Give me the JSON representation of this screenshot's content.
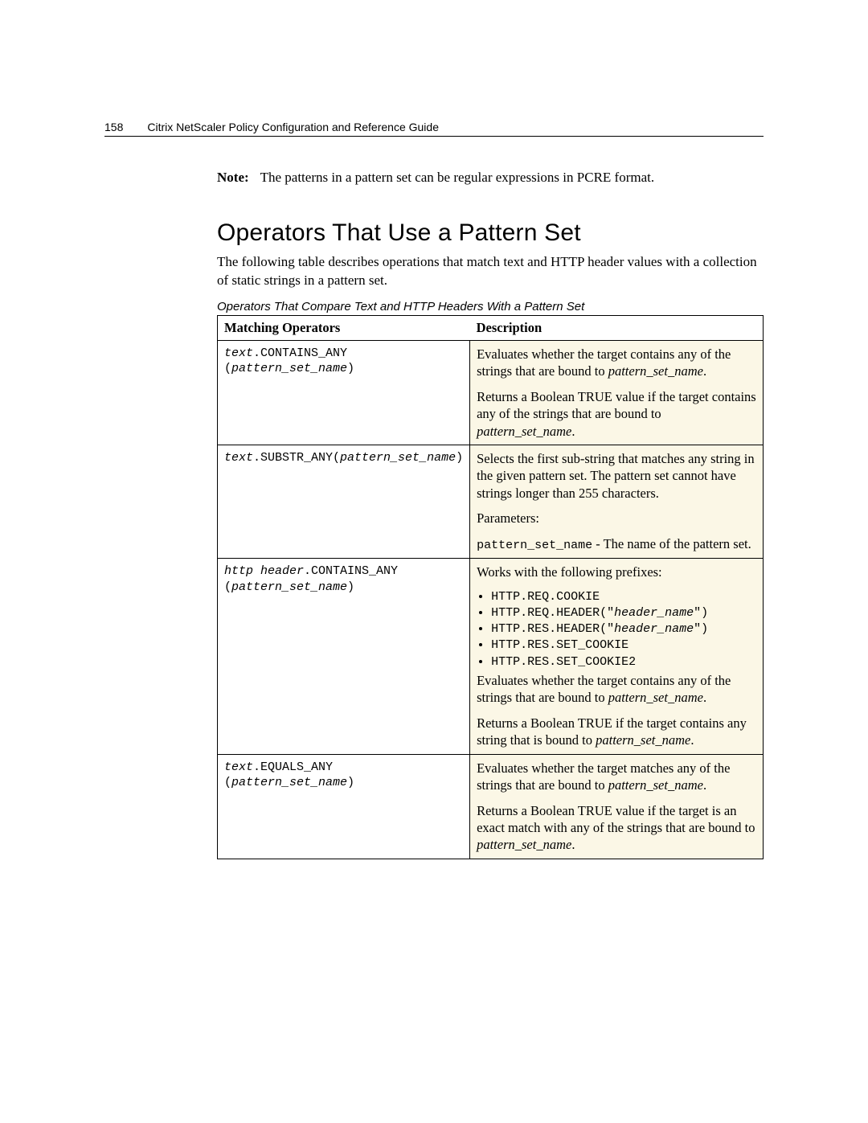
{
  "header": {
    "page_number": "158",
    "doc_title": "Citrix NetScaler Policy Configuration and Reference Guide"
  },
  "note": {
    "label": "Note:",
    "text": "The patterns in a pattern set can be regular expressions in PCRE format."
  },
  "section": {
    "title": "Operators That Use a Pattern Set",
    "intro": "The following table describes operations that match text and HTTP header values with a collection of static strings in a pattern set.",
    "caption": "Operators That Compare Text and HTTP Headers With a Pattern Set"
  },
  "table": {
    "headers": {
      "op": "Matching Operators",
      "desc": "Description"
    },
    "rows": {
      "r1": {
        "op_pre": "text",
        "op_mid": ".CONTAINS_ANY (",
        "op_param": "pattern_set_name",
        "op_post": ")",
        "d1a": "Evaluates whether the target contains any of the strings that are bound to ",
        "d1b": "pattern_set_name",
        "d1c": ".",
        "d2a": "Returns a Boolean TRUE value if the target contains any of the strings that are bound to ",
        "d2b": "pattern_set_name",
        "d2c": "."
      },
      "r2": {
        "op_pre": "text",
        "op_mid": ".SUBSTR_ANY(",
        "op_param": "pattern_set_name",
        "op_post": ")",
        "d1": "Selects the first sub-string that matches any string in the given pattern set. The pattern set cannot have strings longer than 255 characters.",
        "d2": "Parameters:",
        "d3a": "pattern_set_name",
        "d3b": " - The name of the pattern set."
      },
      "r3": {
        "op_pre": "http header",
        "op_mid": ".CONTAINS_ANY (",
        "op_param": "pattern_set_name",
        "op_post": ")",
        "d1": "Works with the following prefixes:",
        "pfx": {
          "a": "HTTP.REQ.COOKIE",
          "b_pre": "HTTP.REQ.HEADER(\"",
          "b_param": "header_name",
          "b_post": "\")",
          "c_pre": "HTTP.RES.HEADER(\"",
          "c_param": "header_name",
          "c_post": "\")",
          "d": "HTTP.RES.SET_COOKIE",
          "e": "HTTP.RES.SET_COOKIE2"
        },
        "d2a": "Evaluates whether the target contains any of the strings that are bound to ",
        "d2b": "pattern_set_name",
        "d2c": ".",
        "d3a": "Returns a Boolean TRUE if the target contains any string that is bound to ",
        "d3b": "pattern_set_name",
        "d3c": "."
      },
      "r4": {
        "op_pre": "text",
        "op_mid": ".EQUALS_ANY (",
        "op_param": "pattern_set_name",
        "op_post": ")",
        "d1a": "Evaluates whether the target matches any of the strings that are bound to ",
        "d1b": "pattern_set_name",
        "d1c": ".",
        "d2a": "Returns a Boolean TRUE value if the target is an exact match with any of the strings that are bound to ",
        "d2b": "pattern_set_name",
        "d2c": "."
      }
    }
  }
}
